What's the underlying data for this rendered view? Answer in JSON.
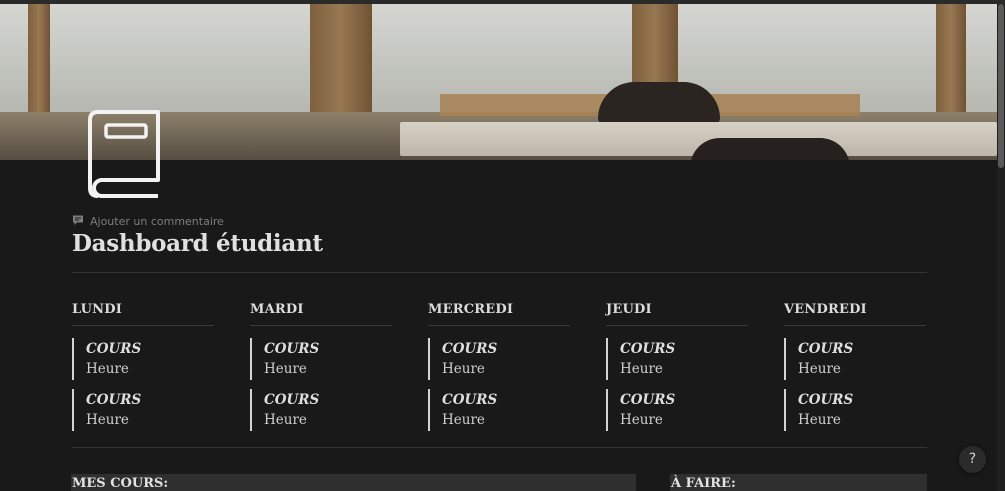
{
  "page": {
    "icon": "book-icon",
    "add_comment": "Ajouter un commentaire",
    "title": "Dashboard étudiant"
  },
  "schedule": {
    "days": [
      {
        "name": "LUNDI",
        "slots": [
          {
            "course": "COURS",
            "time": "Heure"
          },
          {
            "course": "COURS",
            "time": "Heure"
          }
        ]
      },
      {
        "name": "MARDI",
        "slots": [
          {
            "course": "COURS",
            "time": "Heure"
          },
          {
            "course": "COURS",
            "time": "Heure"
          }
        ]
      },
      {
        "name": "MERCREDI",
        "slots": [
          {
            "course": "COURS",
            "time": "Heure"
          },
          {
            "course": "COURS",
            "time": "Heure"
          }
        ]
      },
      {
        "name": "JEUDI",
        "slots": [
          {
            "course": "COURS",
            "time": "Heure"
          },
          {
            "course": "COURS",
            "time": "Heure"
          }
        ]
      },
      {
        "name": "VENDREDI",
        "slots": [
          {
            "course": "COURS",
            "time": "Heure"
          },
          {
            "course": "COURS",
            "time": "Heure"
          }
        ]
      }
    ]
  },
  "sections": {
    "courses": "MES COURS:",
    "todo": "À FAIRE:"
  },
  "help": {
    "label": "?"
  },
  "colors": {
    "background": "#191919",
    "text": "#d4d4d4",
    "section_bg": "#2f2f2f"
  }
}
